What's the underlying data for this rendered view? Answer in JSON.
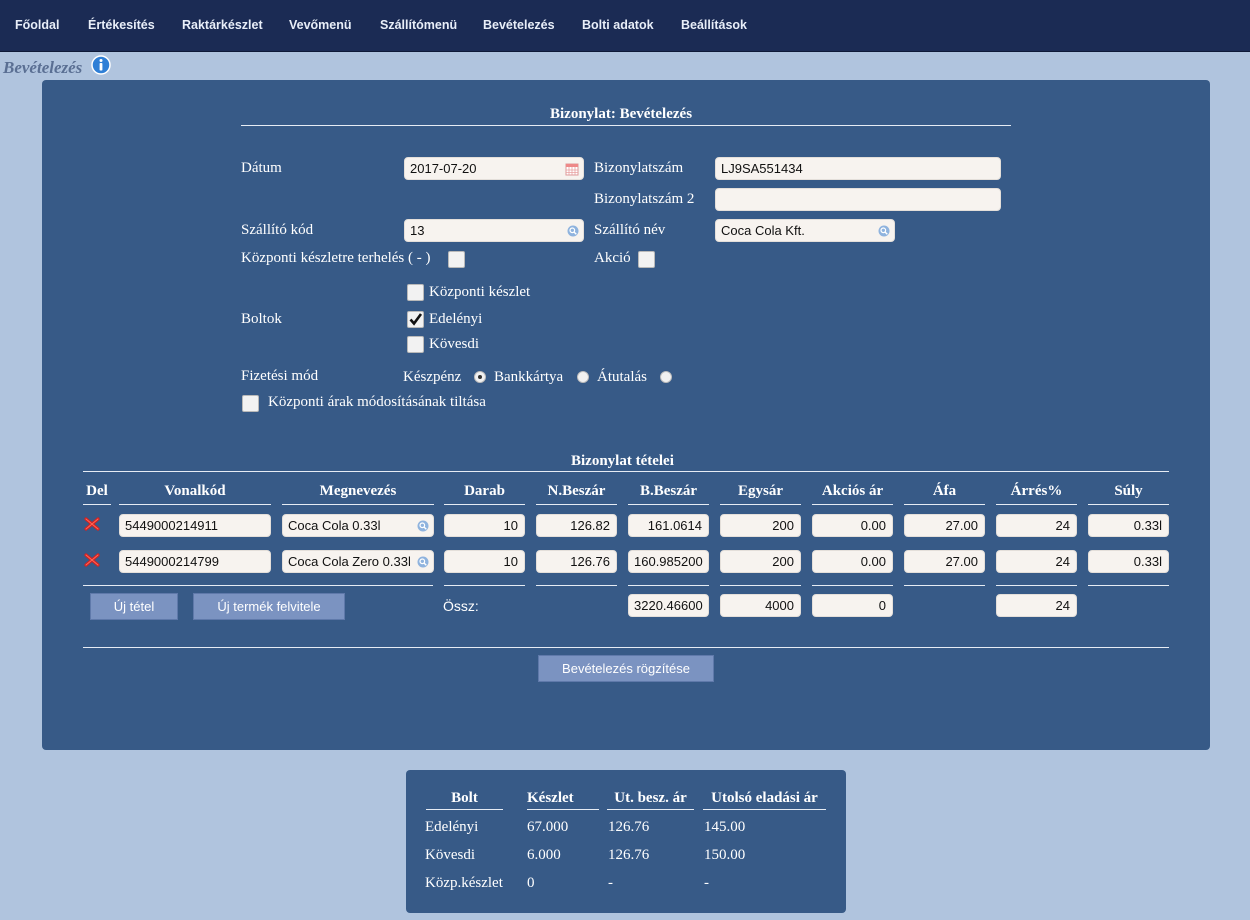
{
  "nav": [
    "Főoldal",
    "Értékesítés",
    "Raktárkészlet",
    "Vevőmenü",
    "Szállítómenü",
    "Bevételezés",
    "Bolti adatok",
    "Beállítások"
  ],
  "page_title": "Bevételezés",
  "form": {
    "heading": "Bizonylat: Bevételezés",
    "date_label": "Dátum",
    "date_value": "2017-07-20",
    "doc_number_label": "Bizonylatszám",
    "doc_number_value": "LJ9SA551434",
    "doc_number2_label": "Bizonylatszám 2",
    "doc_number2_value": "",
    "supplier_code_label": "Szállító kód",
    "supplier_code_value": "13",
    "supplier_name_label": "Szállító név",
    "supplier_name_value": "Coca Cola Kft.",
    "central_charge_label": "Központi készletre terhelés ( - )",
    "central_charge_checked": false,
    "promo_label": "Akció",
    "promo_checked": false,
    "shops_label": "Boltok",
    "shops": [
      {
        "label": "Központi készlet",
        "checked": false
      },
      {
        "label": "Edelényi",
        "checked": true
      },
      {
        "label": "Kövesdi",
        "checked": false
      }
    ],
    "payment_label": "Fizetési mód",
    "payment_options": [
      {
        "label": "Készpénz",
        "selected": true
      },
      {
        "label": "Bankkártya",
        "selected": false
      },
      {
        "label": "Átutalás",
        "selected": false
      }
    ],
    "price_lock_label": "Központi árak módosításának tiltása",
    "price_lock_checked": false
  },
  "items": {
    "heading": "Bizonylat tételei",
    "columns": [
      "Del",
      "Vonalkód",
      "Megnevezés",
      "Darab",
      "N.Beszár",
      "B.Beszár",
      "Egysár",
      "Akciós ár",
      "Áfa",
      "Árrés%",
      "Súly"
    ],
    "rows": [
      {
        "barcode": "5449000214911",
        "name": "Coca Cola 0.33l",
        "qty": "10",
        "net_price": "126.82",
        "gross_price": "161.0614",
        "unit_price": "200",
        "promo_price": "0.00",
        "vat": "27.00",
        "margin": "24",
        "weight": "0.33l"
      },
      {
        "barcode": "5449000214799",
        "name": "Coca Cola Zero 0.33l",
        "qty": "10",
        "net_price": "126.76",
        "gross_price": "160.985200",
        "unit_price": "200",
        "promo_price": "0.00",
        "vat": "27.00",
        "margin": "24",
        "weight": "0.33l"
      }
    ],
    "new_item_button": "Új tétel",
    "new_product_button": "Új termék felvitele",
    "total_label": "Össz:",
    "total_gross": "3220.46600",
    "total_unit": "4000",
    "total_promo": "0",
    "total_margin": "24",
    "save_button": "Bevételezés rögzítése"
  },
  "summary": {
    "columns": [
      "Bolt",
      "Készlet",
      "Ut. besz. ár",
      "Utolsó eladási ár"
    ],
    "rows": [
      [
        "Edelényi",
        "67.000",
        "126.76",
        "145.00"
      ],
      [
        "Kövesdi",
        "6.000",
        "126.76",
        "150.00"
      ],
      [
        "Közp.készlet",
        "0",
        "-",
        "-"
      ]
    ]
  },
  "colors": {
    "nav_bg": "#1b2b54",
    "page_bg": "#b0c4de",
    "panel_bg": "#375a87",
    "button_bg": "#7b93c1",
    "delete_icon": "#d42020",
    "info_icon": "#2f7fd6"
  }
}
